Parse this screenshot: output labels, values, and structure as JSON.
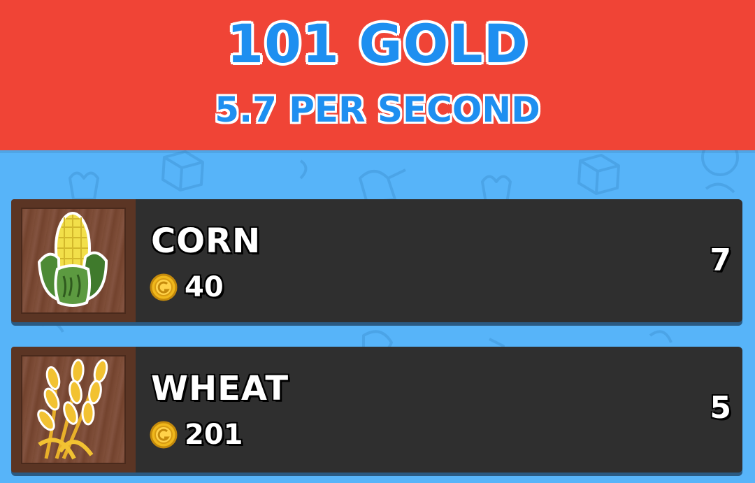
{
  "header": {
    "gold_total": "101 GOLD",
    "rate": "5.7 PER SECOND"
  },
  "colors": {
    "header_bg": "#f04436",
    "page_bg": "#57b4f9",
    "title_blue": "#1e8ff0",
    "card_bg": "#2f2f2f",
    "thumb_frame": "#5b3524"
  },
  "crops": [
    {
      "name": "CORN",
      "icon": "corn-icon",
      "price": "40",
      "owned": "7"
    },
    {
      "name": "WHEAT",
      "icon": "wheat-icon",
      "price": "201",
      "owned": "5"
    }
  ],
  "currency_icon": "gold-coin-icon"
}
